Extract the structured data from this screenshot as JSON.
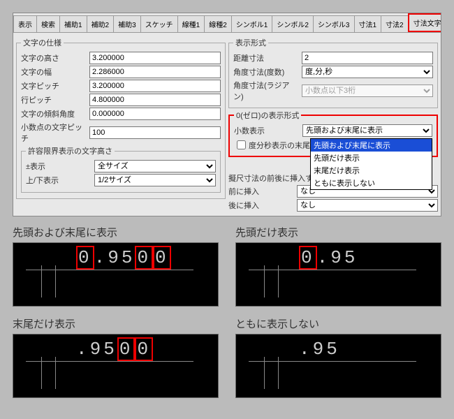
{
  "tabs": [
    "表示",
    "検索",
    "補助1",
    "補助2",
    "補助3",
    "スケッチ",
    "線種1",
    "線種2",
    "シンボル1",
    "シンボル2",
    "シンボル3",
    "寸法1",
    "寸法2",
    "寸法文字"
  ],
  "tab_end_glyph": "◁",
  "left_group_title": "文字の仕様",
  "rows_left": {
    "height": {
      "label": "文字の高さ",
      "value": "3.200000"
    },
    "width": {
      "label": "文字の幅",
      "value": "2.286000"
    },
    "pitch": {
      "label": "文字ピッチ",
      "value": "3.200000"
    },
    "linepitch": {
      "label": "行ピッチ",
      "value": "4.800000"
    },
    "slant": {
      "label": "文字の傾斜角度",
      "value": "0.000000"
    },
    "decpitch": {
      "label": "小数点の文字ピッチ",
      "value": "100"
    }
  },
  "tol_group_title": "許容限界表示の文字高さ",
  "rows_tol": {
    "plus": {
      "label": "±表示",
      "value": "全サイズ"
    },
    "updn": {
      "label": "上/下表示",
      "value": "1/2サイズ"
    }
  },
  "right_group_title": "表示形式",
  "rows_right": {
    "dist": {
      "label": "距離寸法",
      "value": "2"
    },
    "angdeg": {
      "label": "角度寸法(度数)",
      "value": "度,分,秒"
    },
    "angrad": {
      "label": "角度寸法(ラジアン)",
      "value": "小数点以下3桁"
    }
  },
  "zero_group_title": "0(ゼロ)の表示形式",
  "zero_label": "小数表示",
  "zero_value": "先頭および末尾に表示",
  "zero_checkbox": "度分秒表示の末尾0を不表示に",
  "zero_options": [
    "先頭および末尾に表示",
    "先頭だけ表示",
    "末尾だけ表示",
    "ともに表示しない"
  ],
  "ctrl_row": {
    "label": "擬尺寸法の前後に挿入する制御文字"
  },
  "before_row": {
    "label": "前に挿入",
    "value": "なし"
  },
  "after_row": {
    "label": "後に挿入",
    "value": "なし"
  },
  "examples": {
    "a": {
      "title": "先頭および末尾に表示",
      "digits": [
        "0",
        ".",
        "9",
        "5",
        "0",
        "0"
      ],
      "hl": [
        0,
        4,
        5
      ]
    },
    "b": {
      "title": "先頭だけ表示",
      "digits": [
        "0",
        ".",
        "9",
        "5"
      ],
      "hl": [
        0
      ]
    },
    "c": {
      "title": "末尾だけ表示",
      "digits": [
        ".",
        "9",
        "5",
        "0",
        "0"
      ],
      "hl": [
        3,
        4
      ]
    },
    "d": {
      "title": "ともに表示しない",
      "digits": [
        ".",
        "9",
        "5"
      ],
      "hl": []
    }
  }
}
